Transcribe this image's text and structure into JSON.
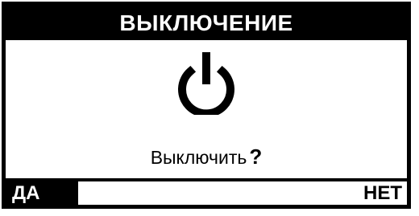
{
  "dialog": {
    "title": "ВЫКЛЮЧЕНИЕ",
    "icon": "power-icon",
    "prompt": "Выключить",
    "prompt_mark": "?"
  },
  "softkeys": {
    "left_label": "ДА",
    "right_label": "НЕТ"
  },
  "colors": {
    "background": "#ffffff",
    "foreground": "#000000"
  }
}
